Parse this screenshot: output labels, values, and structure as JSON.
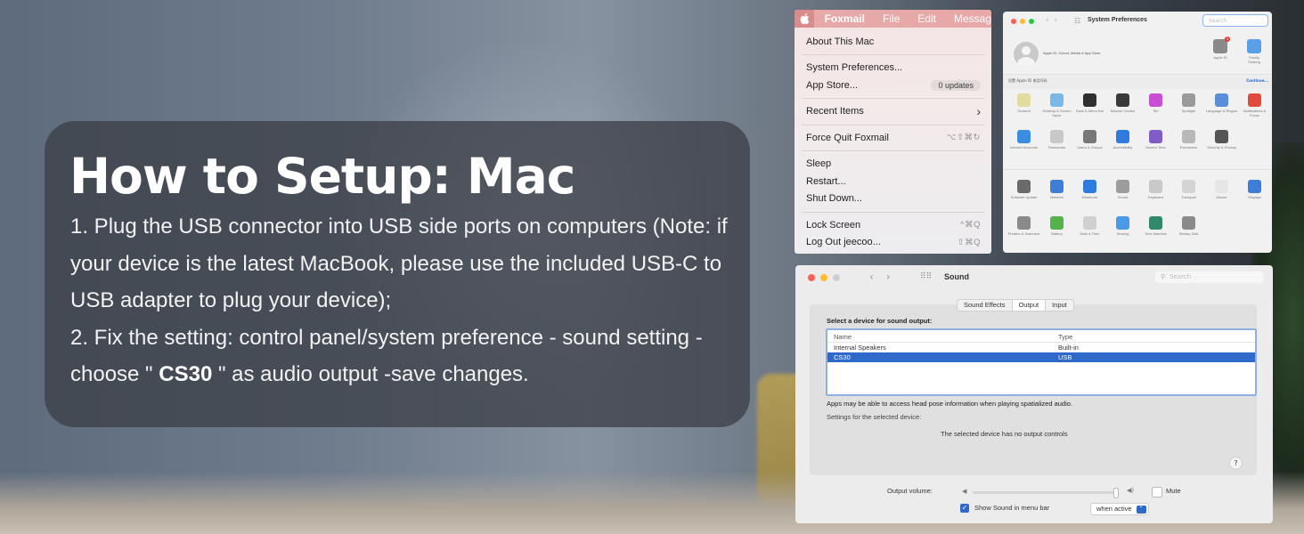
{
  "colors": {
    "card_bg": "#3c4048",
    "menubar_pink": "#e7a8a8",
    "selection_blue": "#2f6acb",
    "traffic_red": "#ff5f57",
    "traffic_yellow": "#febc2e",
    "traffic_gray": "#cfcfcf"
  },
  "setup": {
    "title": "How to Setup: Mac",
    "line1": "1. Plug the USB connector into USB side ports on computers (Note: if your device is the latest MacBook, please use the included USB-C to USB adapter to plug your device);",
    "line2_pre": "2. Fix the setting: control panel/system preference - sound setting - choose \"",
    "line2_device": "CS30",
    "line2_post": "\" as audio output -save changes."
  },
  "apple_menu": {
    "menubar": {
      "app": "Foxmail",
      "file": "File",
      "edit": "Edit",
      "messages": "Messag"
    },
    "items": {
      "about": "About This Mac",
      "system_prefs": "System Preferences...",
      "app_store": "App Store...",
      "app_store_badge": "0 updates",
      "recent": "Recent Items",
      "recent_arrow": "›",
      "force_quit": "Force Quit Foxmail",
      "force_quit_sc": "⌥⇧⌘↻",
      "sleep": "Sleep",
      "restart": "Restart...",
      "shutdown": "Shut Down...",
      "lock": "Lock Screen",
      "lock_sc": "^⌘Q",
      "logout": "Log Out jeecoo...",
      "logout_sc": "⇧⌘Q"
    }
  },
  "system_prefs": {
    "title": "System Preferences",
    "search_placeholder": "Search",
    "account_text": "Apple ID, iCloud, Media & App Store",
    "apple_id_label": "Apple ID",
    "apple_id_badge": "1",
    "family_label": "Family Sharing",
    "strip_left": "设置 Apple ID 电话号码",
    "strip_right": "Continue...",
    "row1": [
      {
        "label": "General",
        "color": "#e3dca0"
      },
      {
        "label": "Desktop & Screen Saver",
        "color": "#7ab8e8"
      },
      {
        "label": "Dock & Menu Bar",
        "color": "#303030"
      },
      {
        "label": "Mission Control",
        "color": "#3a3a3a"
      },
      {
        "label": "Siri",
        "color": "#c64fd6"
      },
      {
        "label": "Spotlight",
        "color": "#9a9a9a"
      },
      {
        "label": "Language & Region",
        "color": "#5b8ed8"
      },
      {
        "label": "Notifications & Focus",
        "color": "#e24a3d"
      }
    ],
    "row2": [
      {
        "label": "Internet Accounts",
        "color": "#3a8de0"
      },
      {
        "label": "Passwords",
        "color": "#c8c8c8"
      },
      {
        "label": "Users & Groups",
        "color": "#777777"
      },
      {
        "label": "Accessibility",
        "color": "#2f7be0"
      },
      {
        "label": "Screen Time",
        "color": "#7f5cc8"
      },
      {
        "label": "Extensions",
        "color": "#b8b8b8"
      },
      {
        "label": "Security & Privacy",
        "color": "#555555"
      }
    ],
    "row3": [
      {
        "label": "Software Update",
        "color": "#6a6a6a"
      },
      {
        "label": "Network",
        "color": "#3d7fd8"
      },
      {
        "label": "Bluetooth",
        "color": "#2f7be0"
      },
      {
        "label": "Sound",
        "color": "#9c9c9c"
      },
      {
        "label": "Keyboard",
        "color": "#c9c9c9"
      },
      {
        "label": "Trackpad",
        "color": "#d4d4d4"
      },
      {
        "label": "Mouse",
        "color": "#e6e6e6"
      },
      {
        "label": "Displays",
        "color": "#3d7fd8"
      }
    ],
    "row4": [
      {
        "label": "Printers & Scanners",
        "color": "#8a8a8a"
      },
      {
        "label": "Battery",
        "color": "#54b34a"
      },
      {
        "label": "Date & Time",
        "color": "#d0d0d0"
      },
      {
        "label": "Sharing",
        "color": "#4a9ae8"
      },
      {
        "label": "Time Machine",
        "color": "#2e8a6a"
      },
      {
        "label": "Startup Disk",
        "color": "#8a8a8a"
      }
    ]
  },
  "sound": {
    "title": "Sound",
    "search_placeholder": "Search",
    "tabs": [
      "Sound Effects",
      "Output",
      "Input"
    ],
    "prompt": "Select a device for sound output:",
    "col_name": "Name",
    "col_type": "Type",
    "devices": [
      {
        "name": "Internal Speakers",
        "type": "Built-in"
      },
      {
        "name": "CS30",
        "type": "USB"
      }
    ],
    "note": "Apps may be able to access head pose information when playing spatialized audio.",
    "settings_label": "Settings for the selected device:",
    "no_controls": "The selected device has no output controls",
    "help": "?",
    "volume_label": "Output volume:",
    "volume_level": 1.0,
    "mute_label": "Mute",
    "show_label": "Show Sound in menu bar",
    "show_checked": "✓",
    "when_value": "when active",
    "when_arrow": "⌃"
  }
}
